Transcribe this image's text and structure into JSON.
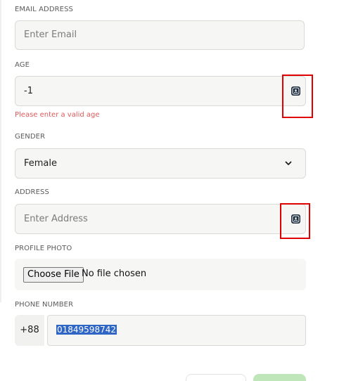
{
  "form": {
    "email": {
      "label": "EMAIL ADDRESS",
      "placeholder": "Enter Email"
    },
    "age": {
      "label": "AGE",
      "value": "-1",
      "error": "Please enter a valid age",
      "assist_icon": "password-manager-icon"
    },
    "gender": {
      "label": "GENDER",
      "selected": "Female",
      "dropdown_icon": "chevron-down-icon"
    },
    "address": {
      "label": "ADDRESS",
      "placeholder": "Enter Address",
      "assist_icon": "password-manager-icon"
    },
    "profile_photo": {
      "label": "PROFILE PHOTO",
      "button_label": "Choose File",
      "status": "No file chosen"
    },
    "phone": {
      "label": "PHONE NUMBER",
      "prefix": "+88",
      "value": "01849598742",
      "value_selected": true
    }
  },
  "colors": {
    "error_text": "#e05a5a",
    "highlight_box": "#e00000",
    "selection": "#2f66c6",
    "primary_button": "#bfe6b9"
  }
}
